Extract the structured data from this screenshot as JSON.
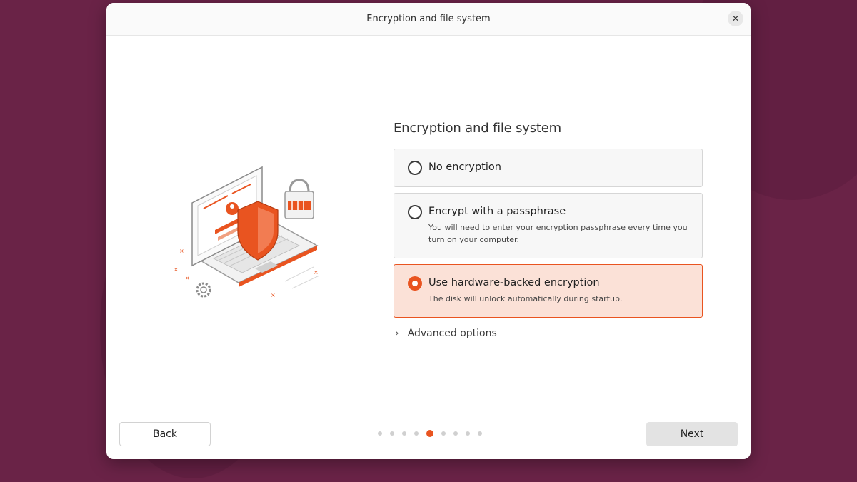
{
  "window": {
    "title": "Encryption and file system",
    "close_icon": "close-icon"
  },
  "main": {
    "heading": "Encryption and file system",
    "options": [
      {
        "label": "No encryption",
        "description": "",
        "selected": false
      },
      {
        "label": "Encrypt with a passphrase",
        "description": "You will need to enter your encryption passphrase every time you turn on your computer.",
        "selected": false
      },
      {
        "label": "Use hardware-backed encryption",
        "description": "The disk will unlock automatically during startup.",
        "selected": true
      }
    ],
    "advanced_label": "Advanced options"
  },
  "footer": {
    "back_label": "Back",
    "next_label": "Next",
    "progress": {
      "total_steps": 9,
      "current_step": 5
    }
  },
  "colors": {
    "accent": "#e95420",
    "background": "#6a2347"
  }
}
